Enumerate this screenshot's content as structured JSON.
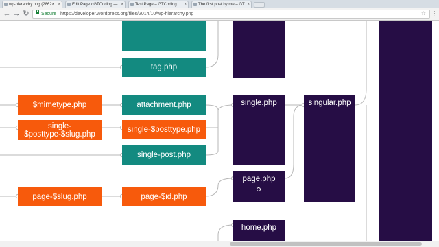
{
  "browser": {
    "tabs": [
      {
        "title": "wp-hierarchy.png (2862×",
        "active": true
      },
      {
        "title": "Edit Page ‹ GTCoding —",
        "active": false
      },
      {
        "title": "Test Page – GTCoding",
        "active": false
      },
      {
        "title": "The first post by me – GT",
        "active": false
      }
    ],
    "close_glyph": "×",
    "secure_label": "Secure",
    "url": "https://developer.wordpress.org/files/2014/10/wp-hierarchy.png"
  },
  "diagram": {
    "nodes": {
      "tag": "tag.php",
      "mimetype": "$mimetype.php",
      "attachment": "attachment.php",
      "single_posttype_slug": "single-\n$posttype-$slug.php",
      "single_posttype": "single-$posttype.php",
      "single_post": "single-post.php",
      "single": "single.php",
      "singular": "singular.php",
      "page_slug": "page-$slug.php",
      "page_id": "page-$id.php",
      "page": "page.php",
      "home": "home.php"
    },
    "colors": {
      "orange": "#f75a0c",
      "teal": "#138a80",
      "purple": "#260d45",
      "connector": "#b7b7b7"
    }
  }
}
